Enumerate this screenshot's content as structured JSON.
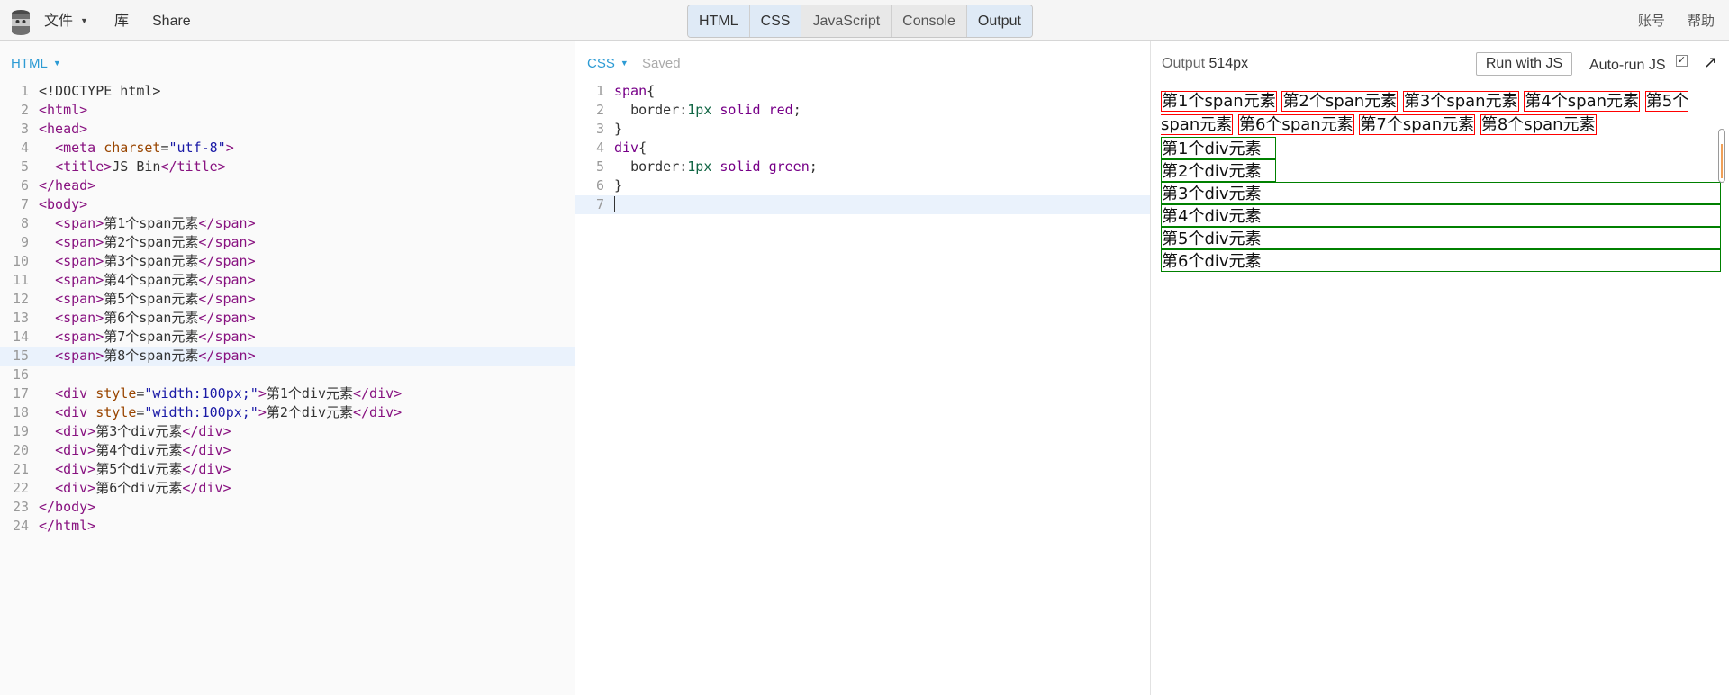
{
  "topbar": {
    "menu_file": "文件",
    "menu_library": "库",
    "menu_share": "Share",
    "tabs": [
      "HTML",
      "CSS",
      "JavaScript",
      "Console",
      "Output"
    ],
    "account": "账号",
    "help": "帮助"
  },
  "html_panel": {
    "label": "HTML",
    "lines": [
      {
        "n": "1"
      },
      {
        "n": "2"
      },
      {
        "n": "3"
      },
      {
        "n": "4"
      },
      {
        "n": "5"
      },
      {
        "n": "6"
      },
      {
        "n": "7"
      },
      {
        "n": "8"
      },
      {
        "n": "9"
      },
      {
        "n": "10"
      },
      {
        "n": "11"
      },
      {
        "n": "12"
      },
      {
        "n": "13"
      },
      {
        "n": "14"
      },
      {
        "n": "15"
      },
      {
        "n": "16"
      },
      {
        "n": "17"
      },
      {
        "n": "18"
      },
      {
        "n": "19"
      },
      {
        "n": "20"
      },
      {
        "n": "21"
      },
      {
        "n": "22"
      },
      {
        "n": "23"
      },
      {
        "n": "24"
      }
    ]
  },
  "css_panel": {
    "label": "CSS",
    "status": "Saved",
    "lines": [
      {
        "n": "1"
      },
      {
        "n": "2"
      },
      {
        "n": "3"
      },
      {
        "n": "4"
      },
      {
        "n": "5"
      },
      {
        "n": "6"
      },
      {
        "n": "7"
      }
    ]
  },
  "output_panel": {
    "title": "Output",
    "width_label": "514px",
    "run_button": "Run with JS",
    "autorun_label": "Auto-run JS",
    "autorun_checked": "✓",
    "spans": [
      "第1个span元素",
      "第2个span元素",
      "第3个span元素",
      "第4个span元素",
      "第5个span元素",
      "第6个span元素",
      "第7个span元素",
      "第8个span元素"
    ],
    "divs": [
      "第1个div元素",
      "第2个div元素",
      "第3个div元素",
      "第4个div元素",
      "第5个div元素",
      "第6个div元素"
    ]
  }
}
